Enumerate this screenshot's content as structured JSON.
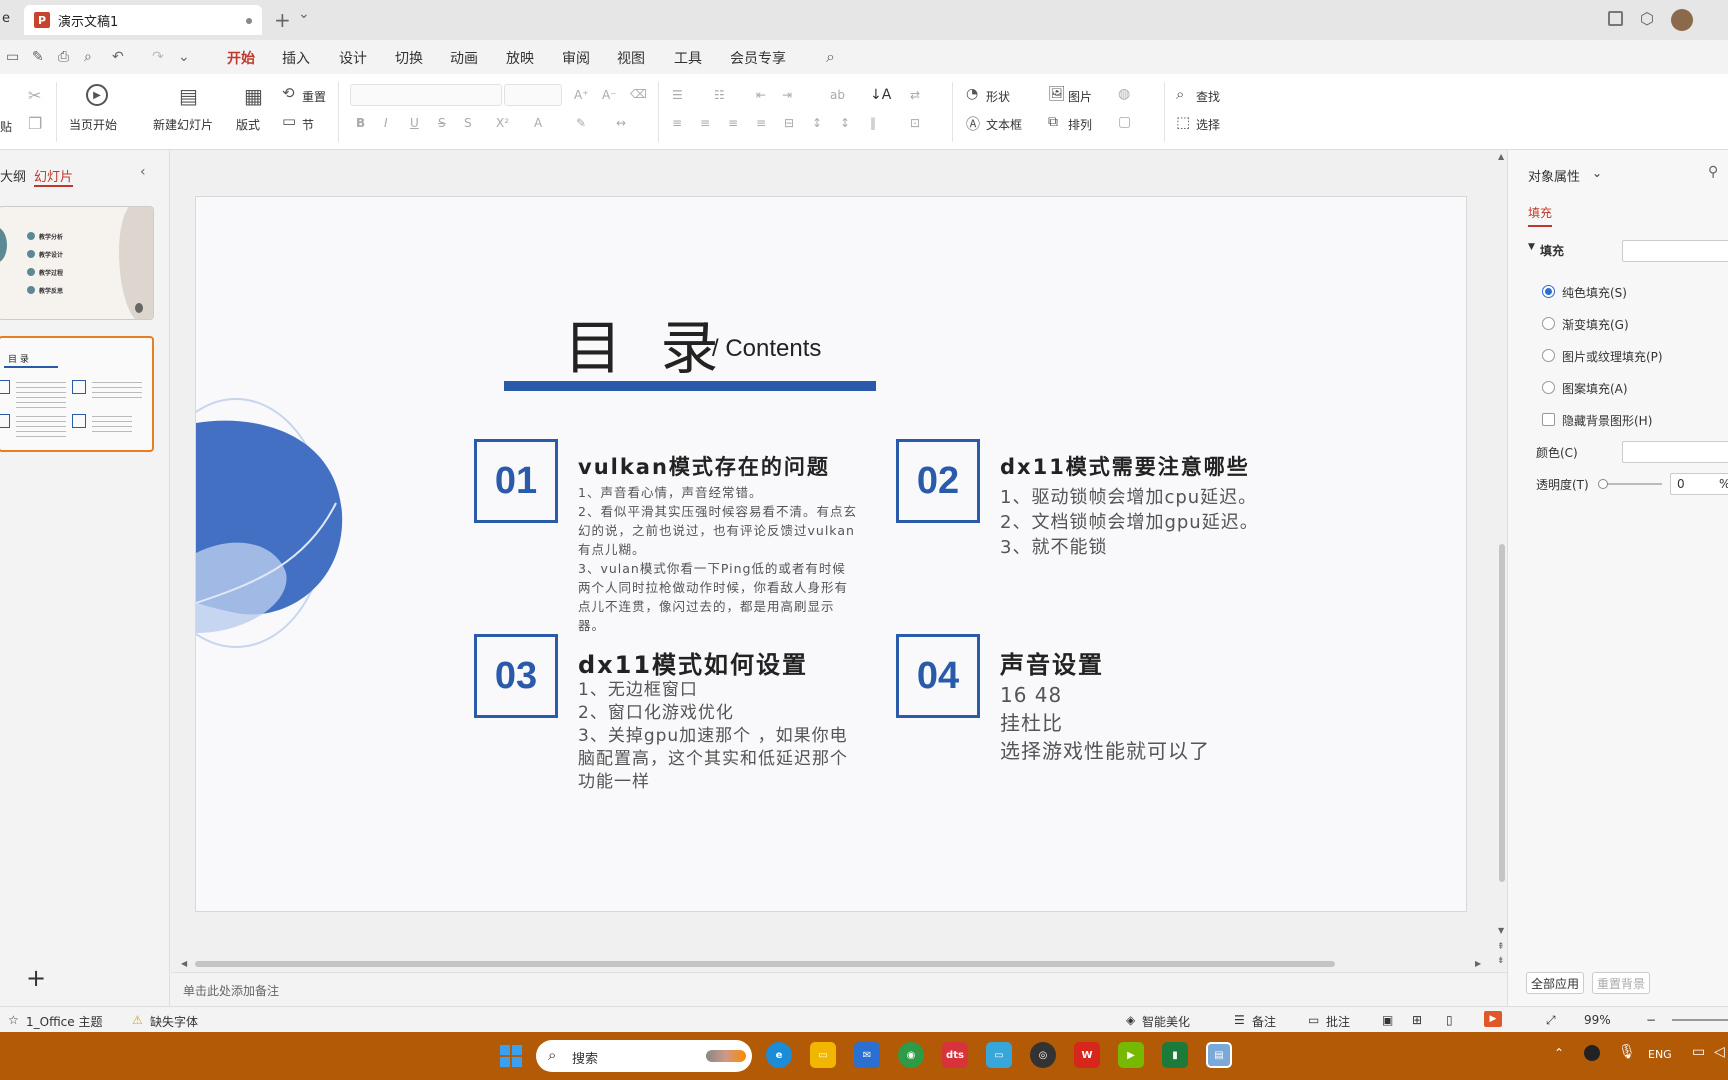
{
  "tabbar": {
    "partial_tab": "e",
    "doc_title": "演示文稿1",
    "doc_icon_letter": "P",
    "new_tab": "+",
    "dropdown": "⌄"
  },
  "menu": {
    "items": [
      "开始",
      "插入",
      "设计",
      "切换",
      "动画",
      "放映",
      "审阅",
      "视图",
      "工具",
      "会员专享"
    ],
    "active": "开始"
  },
  "ribbon": {
    "play_from_current": "当页开始",
    "new_slide": "新建幻灯片",
    "layout": "版式",
    "reset": "重置",
    "section": "节",
    "shape": "形状",
    "picture": "图片",
    "textbox": "文本框",
    "arrange": "排列",
    "find": "查找",
    "select": "选择",
    "paste_partial": "贴"
  },
  "left_panel": {
    "tab_outline": "大纲",
    "tab_slides": "幻灯片",
    "add_slide": "+"
  },
  "slide": {
    "title": "目 录",
    "subtitle": "/ Contents",
    "sections": [
      {
        "num": "01",
        "title": "vulkan模式存在的问题",
        "body": "1、声音看心情，声音经常错。\n2、看似平滑其实压强时候容易看不清。有点玄幻的说，之前也说过，也有评论反馈过vulkan有点儿糊。\n3、vulan模式你看一下Ping低的或者有时候两个人同时拉枪做动作时候，你看敌人身形有点儿不连贯，像闪过去的，都是用高刷显示器。"
      },
      {
        "num": "02",
        "title": "dx11模式需要注意哪些",
        "body": "1、驱动锁帧会增加cpu延迟。\n2、文档锁帧会增加gpu延迟。\n3、就不能锁"
      },
      {
        "num": "03",
        "title": "dx11模式如何设置",
        "body": "1、无边框窗口\n2、窗口化游戏优化\n3、关掉gpu加速那个 ，如果你电脑配置高，这个其实和低延迟那个功能一样"
      },
      {
        "num": "04",
        "title": "声音设置",
        "body": "16 48\n挂杜比\n选择游戏性能就可以了"
      }
    ]
  },
  "thumb1": {
    "items": [
      "教学分析",
      "教学设计",
      "教学过程",
      "教学反思"
    ]
  },
  "thumb2": {
    "title": "目 录"
  },
  "right_panel": {
    "header": "对象属性",
    "tab_fill": "填充",
    "section_fill": "填充",
    "options": [
      "纯色填充(S)",
      "渐变填充(G)",
      "图片或纹理填充(P)",
      "图案填充(A)"
    ],
    "hide_bg": "隐藏背景图形(H)",
    "color_label": "颜色(C)",
    "transparency_label": "透明度(T)",
    "transparency_value": "0",
    "percent": "%",
    "apply_all": "全部应用",
    "reset_bg": "重置背景"
  },
  "notes": {
    "placeholder": "单击此处添加备注"
  },
  "statusbar": {
    "theme": "1_Office 主题",
    "missing_font": "缺失字体",
    "smart_beautify": "智能美化",
    "notes": "备注",
    "comments": "批注",
    "zoom": "99%"
  },
  "taskbar": {
    "search": "搜索",
    "lang": "ENG"
  },
  "colors": {
    "accent": "#2a5baa",
    "active_tab": "#c0392b",
    "taskbar": "#b25a06"
  }
}
